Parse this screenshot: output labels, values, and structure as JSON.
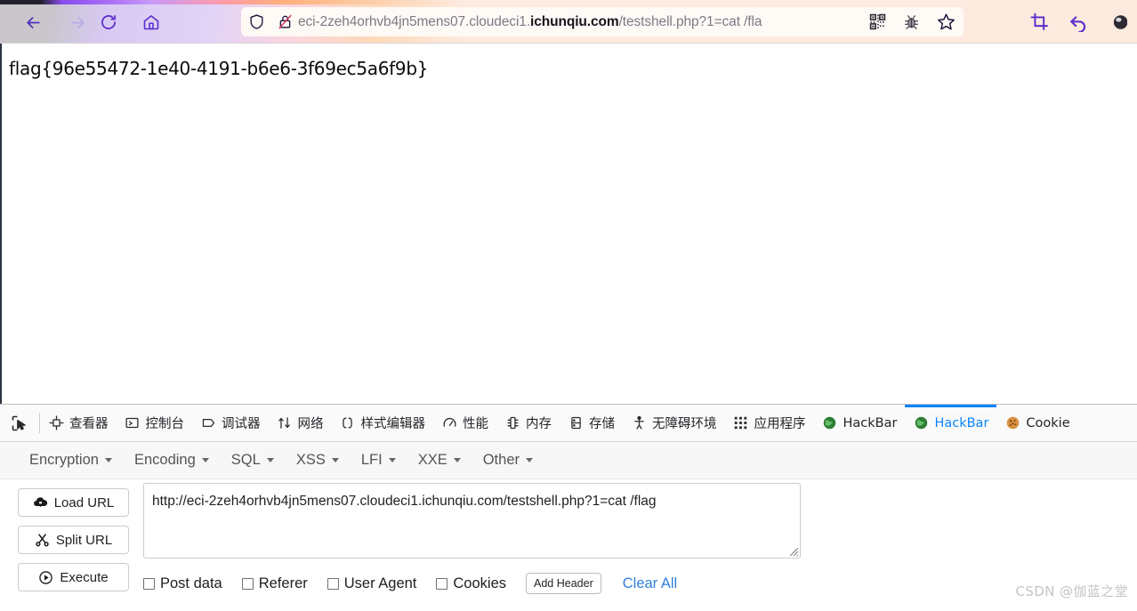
{
  "browser": {
    "nav": {
      "back_label": "Back",
      "forward_label": "Forward",
      "reload_label": "Reload",
      "home_label": "Home"
    },
    "urlbar": {
      "prefix": "eci-2zeh4orhvb4jn5mens07.cloudeci1.",
      "domain": "ichunqiu.com",
      "suffix": "/testshell.php?1=cat /fla",
      "shield_icon": "shield-icon",
      "lock_icon": "lock-broken-icon",
      "qr_icon": "qr-code-icon",
      "bug_icon": "bug-extension-icon",
      "star_icon": "bookmark-star-icon"
    },
    "right_icons": [
      {
        "name": "screenshot-crop-icon",
        "glyph": "crop"
      },
      {
        "name": "undo-arrow-icon",
        "glyph": "undo"
      },
      {
        "name": "account-circle-icon",
        "glyph": "circle"
      }
    ]
  },
  "page": {
    "flag": "flag{96e55472-1e40-4191-b6e6-3f69ec5a6f9b}"
  },
  "devtools": {
    "picker_label": "Pick an element",
    "tabs": [
      {
        "label": "查看器",
        "icon": "inspector-icon",
        "active": false
      },
      {
        "label": "控制台",
        "icon": "console-icon",
        "active": false
      },
      {
        "label": "调试器",
        "icon": "debugger-icon",
        "active": false
      },
      {
        "label": "网络",
        "icon": "network-icon",
        "active": false
      },
      {
        "label": "样式编辑器",
        "icon": "style-editor-icon",
        "active": false
      },
      {
        "label": "性能",
        "icon": "performance-icon",
        "active": false
      },
      {
        "label": "内存",
        "icon": "memory-icon",
        "active": false
      },
      {
        "label": "存储",
        "icon": "storage-icon",
        "active": false
      },
      {
        "label": "无障碍环境",
        "icon": "accessibility-icon",
        "active": false
      },
      {
        "label": "应用程序",
        "icon": "application-icon",
        "active": false
      },
      {
        "label": "HackBar",
        "icon": "hackbar-icon",
        "active": false
      },
      {
        "label": "HackBar",
        "icon": "hackbar-icon",
        "active": true
      },
      {
        "label": "Cookie",
        "icon": "cookie-icon",
        "active": false
      }
    ],
    "active_tab_color": "#0a84ff"
  },
  "hackbar": {
    "menus": [
      {
        "label": "Encryption"
      },
      {
        "label": "Encoding"
      },
      {
        "label": "SQL"
      },
      {
        "label": "XSS"
      },
      {
        "label": "LFI"
      },
      {
        "label": "XXE"
      },
      {
        "label": "Other"
      }
    ],
    "buttons": [
      {
        "label": "Load URL",
        "icon": "cloud-download-icon"
      },
      {
        "label": "Split URL",
        "icon": "scissors-icon"
      },
      {
        "label": "Execute",
        "icon": "play-circle-icon"
      }
    ],
    "url_value": "http://eci-2zeh4orhvb4jn5mens07.cloudeci1.ichunqiu.com/testshell.php?1=cat /flag",
    "url_placeholder": "",
    "checkboxes": [
      {
        "label": "Post data",
        "checked": false
      },
      {
        "label": "Referer",
        "checked": false
      },
      {
        "label": "User Agent",
        "checked": false
      },
      {
        "label": "Cookies",
        "checked": false
      }
    ],
    "add_header_label": "Add Header",
    "clear_all_label": "Clear All",
    "link_color": "#2f7fdb"
  },
  "watermark": "CSDN @伽蓝之堂"
}
